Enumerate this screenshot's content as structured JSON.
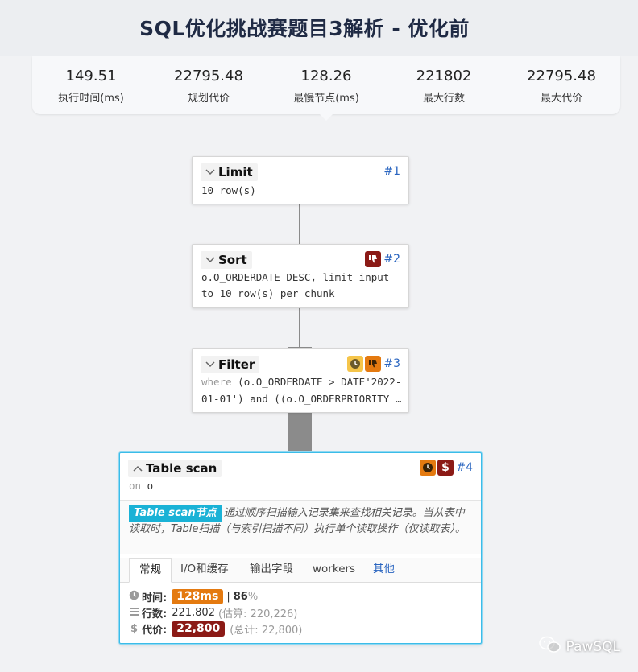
{
  "page": {
    "title": "SQL优化挑战赛题目3解析 - 优化前"
  },
  "stats": [
    {
      "value": "149.51",
      "label": "执行时间(ms)"
    },
    {
      "value": "22795.48",
      "label": "规划代价"
    },
    {
      "value": "128.26",
      "label": "最慢节点(ms)"
    },
    {
      "value": "221802",
      "label": "最大行数"
    },
    {
      "value": "22795.48",
      "label": "最大代价"
    }
  ],
  "nodes": {
    "limit": {
      "name": "Limit",
      "id": "#1",
      "desc": "10 row(s)"
    },
    "sort": {
      "name": "Sort",
      "id": "#2",
      "desc_line1": "o.O_ORDERDATE DESC, limit input",
      "desc_line2": "to 10 row(s) per chunk",
      "badges": [
        "thumbs-down-icon"
      ]
    },
    "filter": {
      "name": "Filter",
      "id": "#3",
      "kw": "where",
      "desc_line1": " (o.O_ORDERDATE > DATE'2022-",
      "desc_line2": "01-01') and ((o.O_ORDERPRIORITY …",
      "badges": [
        "clock-icon",
        "thumbs-down-icon"
      ]
    },
    "tablescan": {
      "name": "Table scan",
      "id": "#4",
      "kw": "on",
      "target": "o",
      "badges": [
        "clock-icon",
        "dollar-icon"
      ],
      "highlight": "Table scan节点",
      "description": "通过顺序扫描输入记录集来查找相关记录。当从表中读取时，Table扫描（与索引扫描不同）执行单个读取操作（仅读取表）。",
      "tabs": [
        "常规",
        "I/O和缓存",
        "输出字段",
        "workers",
        "其他"
      ],
      "metrics": {
        "time_label": "时间:",
        "time_value": "128ms",
        "time_sep": "|",
        "time_pct": "86",
        "time_pct_unit": "%",
        "rows_label": "行数:",
        "rows_value": "221,802",
        "rows_est": "(估算: 220,226)",
        "cost_label": "代价:",
        "cost_value": "22,800",
        "cost_total": "(总计: 22,800)"
      }
    }
  },
  "watermark": {
    "text": "PawSQL"
  },
  "colors": {
    "accent": "#2a65c0",
    "active_border": "#3bbce8",
    "bad": "#8b1a16",
    "warn": "#e47a10",
    "warn_light": "#f5c54a",
    "highlight": "#1ab2d6"
  }
}
